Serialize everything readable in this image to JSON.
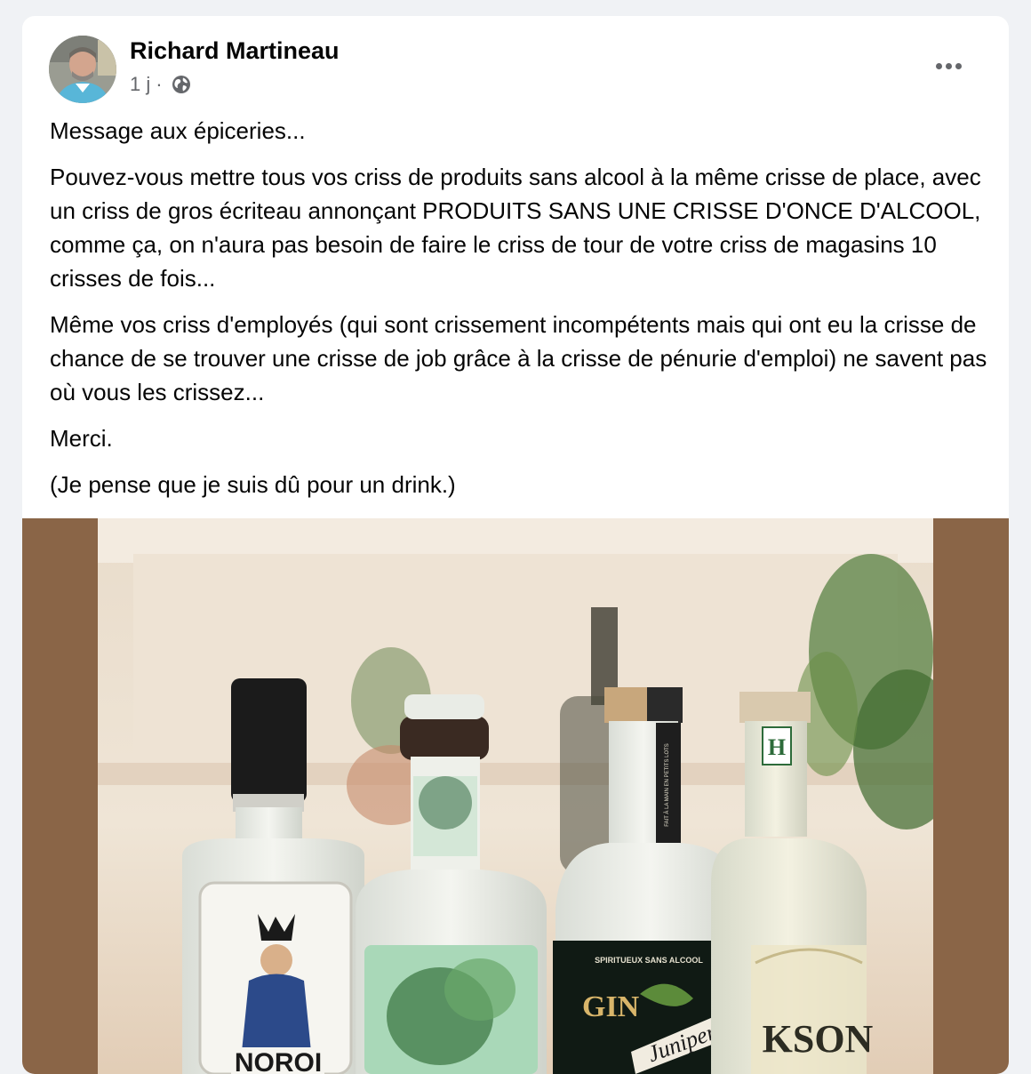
{
  "post": {
    "author": "Richard Martineau",
    "time": "1 j",
    "separator": "·",
    "privacy_icon": "globe-icon",
    "more_icon": "more-options-icon",
    "paragraphs": [
      "Message aux épiceries...",
      "Pouvez-vous mettre tous vos criss de produits sans alcool à la même crisse de place, avec un criss de gros écriteau annonçant PRODUITS SANS UNE CRISSE D'ONCE D'ALCOOL, comme ça, on n'aura pas besoin de faire le criss de tour de votre criss de magasins 10 crisses de fois...",
      "Même vos criss d'employés (qui sont crissement incompétents mais qui ont eu la crisse de chance de se trouver une crisse de job grâce à la crisse de pénurie d'emploi) ne savent pas où vous les crissez...",
      "Merci.",
      "(Je pense que je suis dû pour un drink.)"
    ]
  },
  "photo": {
    "bottle_labels": {
      "b1_label": "NOROI",
      "b3_top": "SPIRITUEUX SANS ALCOOL",
      "b3_gin": "GIN",
      "b3_script": "Juniper",
      "b3_side": "FAIT À LA MAIN EN PETITS LOTS",
      "b4_badge": "H",
      "b4_label": "KSON"
    }
  },
  "colors": {
    "card_bg": "#ffffff",
    "page_bg": "#f0f2f5",
    "text": "#050505",
    "secondary_text": "#65676b",
    "photo_side_bg": "#8a6547"
  }
}
